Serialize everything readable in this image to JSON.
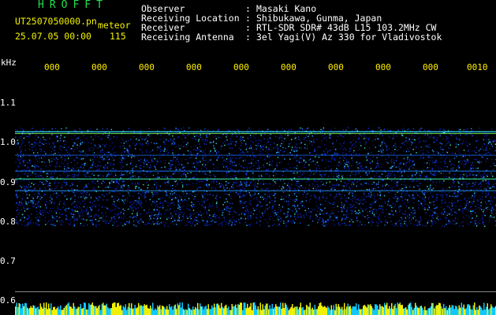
{
  "header": {
    "title": "HROFFT",
    "file_name": "UT2507050000.pn",
    "meteor_label": "meteor",
    "datetime": "25.07.05 00:00",
    "count": "115"
  },
  "meta": [
    {
      "key": "Observer",
      "value": "Masaki Kano"
    },
    {
      "key": "Receiving Location",
      "value": "Shibukawa, Gunma, Japan"
    },
    {
      "key": "Receiver",
      "value": "RTL-SDR SDR# 43dB L15 103.2MHz CW"
    },
    {
      "key": "Receiving Antenna",
      "value": "3el Yagi(V) Az 330 for Vladivostok"
    }
  ],
  "colon": ":",
  "y_unit": "kHz",
  "y_ticks": [
    "1.1",
    "1.0",
    "0.9",
    "0.8",
    "0.7",
    "0.6"
  ],
  "x_ticks": [
    "000",
    "000",
    "000",
    "000",
    "000",
    "000",
    "000",
    "000",
    "000",
    "0010"
  ],
  "colors": {
    "title": "#22e04a",
    "file": "#f0f000",
    "labels": "#ffffff",
    "ticks": "#f0f000",
    "background": "#000000"
  }
}
